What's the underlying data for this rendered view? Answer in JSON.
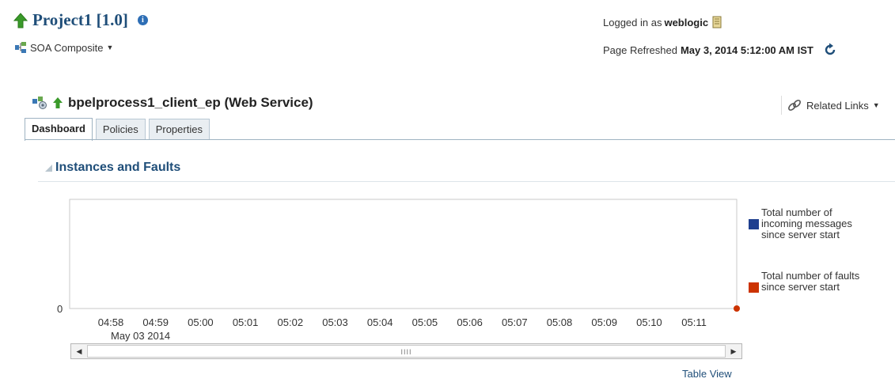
{
  "header": {
    "title": "Project1 [1.0]",
    "composite_menu": "SOA Composite",
    "logged_in_prefix": "Logged in as",
    "user": "weblogic",
    "refreshed_prefix": "Page Refreshed",
    "refreshed_time": "May 3, 2014 5:12:00 AM IST"
  },
  "service": {
    "title": "bpelprocess1_client_ep (Web Service)",
    "related_links": "Related Links"
  },
  "tabs": [
    {
      "label": "Dashboard",
      "active": true
    },
    {
      "label": "Policies",
      "active": false
    },
    {
      "label": "Properties",
      "active": false
    }
  ],
  "section": {
    "title": "Instances and Faults"
  },
  "chart_data": {
    "type": "line",
    "x": [
      "04:58",
      "04:59",
      "05:00",
      "05:01",
      "05:02",
      "05:03",
      "05:04",
      "05:05",
      "05:06",
      "05:07",
      "05:08",
      "05:09",
      "05:10",
      "05:11"
    ],
    "date_label": "May 03 2014",
    "y_ticks": [
      "0"
    ],
    "series": [
      {
        "name": "Total number of incoming messages since server start",
        "color": "#1f3f8f"
      },
      {
        "name": "Total number of faults since server start",
        "color": "#cc3300",
        "last_point": 0
      }
    ],
    "legend": "right"
  },
  "footer": {
    "table_view": "Table View"
  },
  "colors": {
    "accent": "#1f4e79",
    "up_arrow": "#3a9a2a"
  }
}
